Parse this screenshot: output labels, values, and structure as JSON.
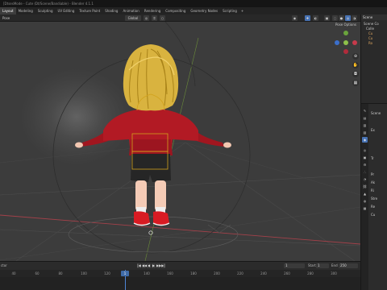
{
  "window": {
    "title": "[DtsesMode - Cute (Dt/Scene/Bandiable) - Blender 4.1.1"
  },
  "workspaces": {
    "tabs": [
      "Layout",
      "Modeling",
      "Sculpting",
      "UV Editing",
      "Texture Paint",
      "Shading",
      "Animation",
      "Rendering",
      "Compositing",
      "Geometry Nodes",
      "Scripting"
    ],
    "add": "+"
  },
  "viewport_header": {
    "mode": "Pose",
    "transform_orientation": "Global"
  },
  "viewport": {
    "pose_options": "Pose Options",
    "nav_icons": [
      "zoom-icon",
      "hand-icon",
      "camera-icon",
      "grid-icon"
    ]
  },
  "timeline": {
    "controls": [
      "|◀",
      "◀◀",
      "◀",
      "▶",
      "▶▶",
      "▶|"
    ],
    "current_frame": "1",
    "start_label": "Start",
    "start_value": "1",
    "end_label": "End",
    "end_value": "250",
    "ruler": [
      "40",
      "60",
      "80",
      "100",
      "120",
      "140",
      "160",
      "180",
      "200",
      "220",
      "240",
      "260",
      "280",
      "300"
    ],
    "badge": "1",
    "left_label": "ctor"
  },
  "outliner": {
    "header": "Scene",
    "rows": [
      "Scene Co",
      "Colle",
      "Cu",
      "Cu",
      "Ro"
    ]
  },
  "properties": {
    "scene_label": "Scene",
    "rows": [
      "Ex",
      "Tr",
      "Pr",
      "Ak",
      "Ri",
      "Stre",
      "Re",
      "Cu"
    ]
  }
}
